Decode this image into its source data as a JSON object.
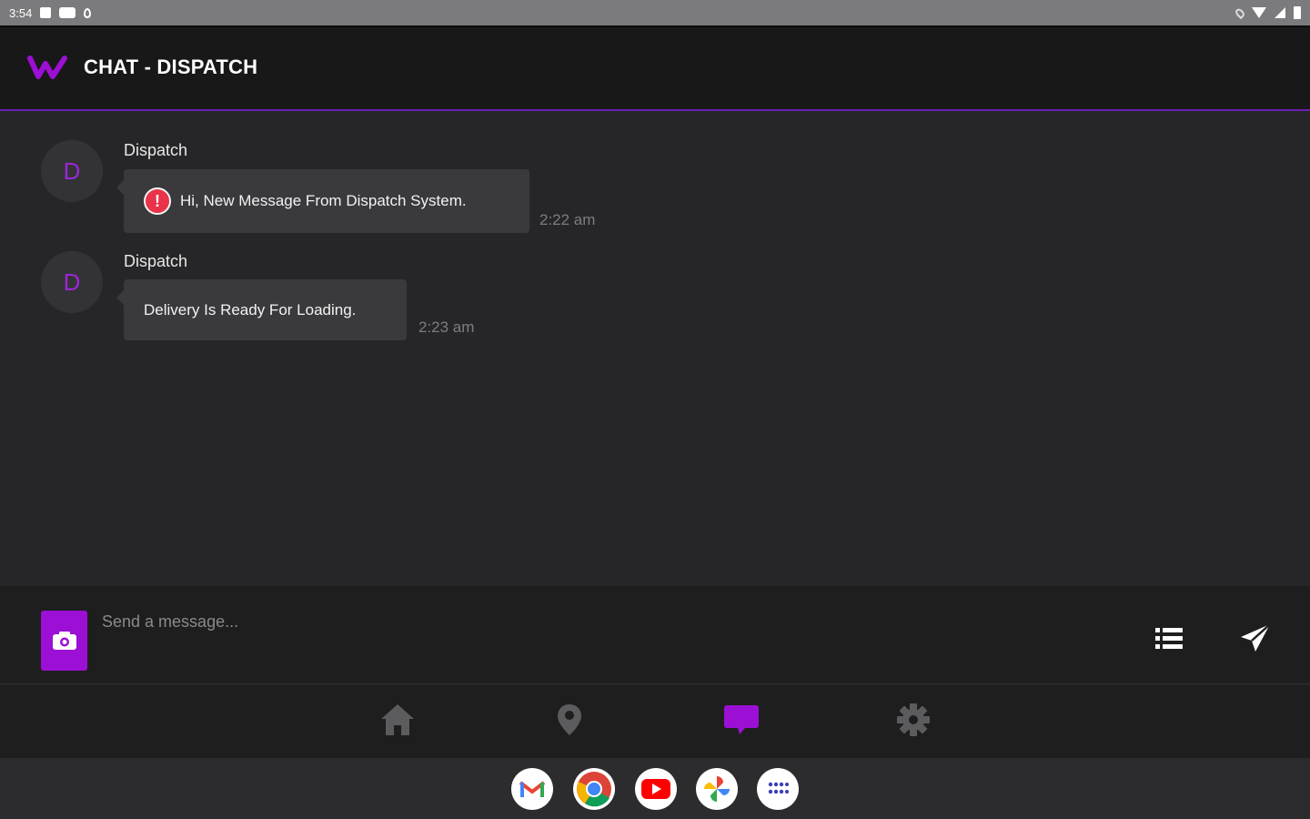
{
  "status_bar": {
    "time": "3:54"
  },
  "app_bar": {
    "title": "CHAT - DISPATCH"
  },
  "messages": [
    {
      "avatar_letter": "D",
      "sender": "Dispatch",
      "text": "Hi, New Message From Dispatch System.",
      "time": "2:22 am",
      "has_alert_icon": true
    },
    {
      "avatar_letter": "D",
      "sender": "Dispatch",
      "text": "Delivery Is Ready For Loading.",
      "time": "2:23 am",
      "has_alert_icon": false
    }
  ],
  "composer": {
    "placeholder": "Send a message..."
  },
  "bottom_nav": [
    {
      "icon": "home-icon",
      "active": false
    },
    {
      "icon": "location-pin-icon",
      "active": false
    },
    {
      "icon": "chat-icon",
      "active": true
    },
    {
      "icon": "gear-icon",
      "active": false
    }
  ],
  "dock_apps": [
    "gmail-icon",
    "chrome-icon",
    "youtube-icon",
    "photos-icon",
    "app-drawer-icon"
  ],
  "colors": {
    "accent": "#9c0fd4",
    "background": "#262628",
    "bubble": "#3a3a3d",
    "alert": "#e8334a"
  }
}
